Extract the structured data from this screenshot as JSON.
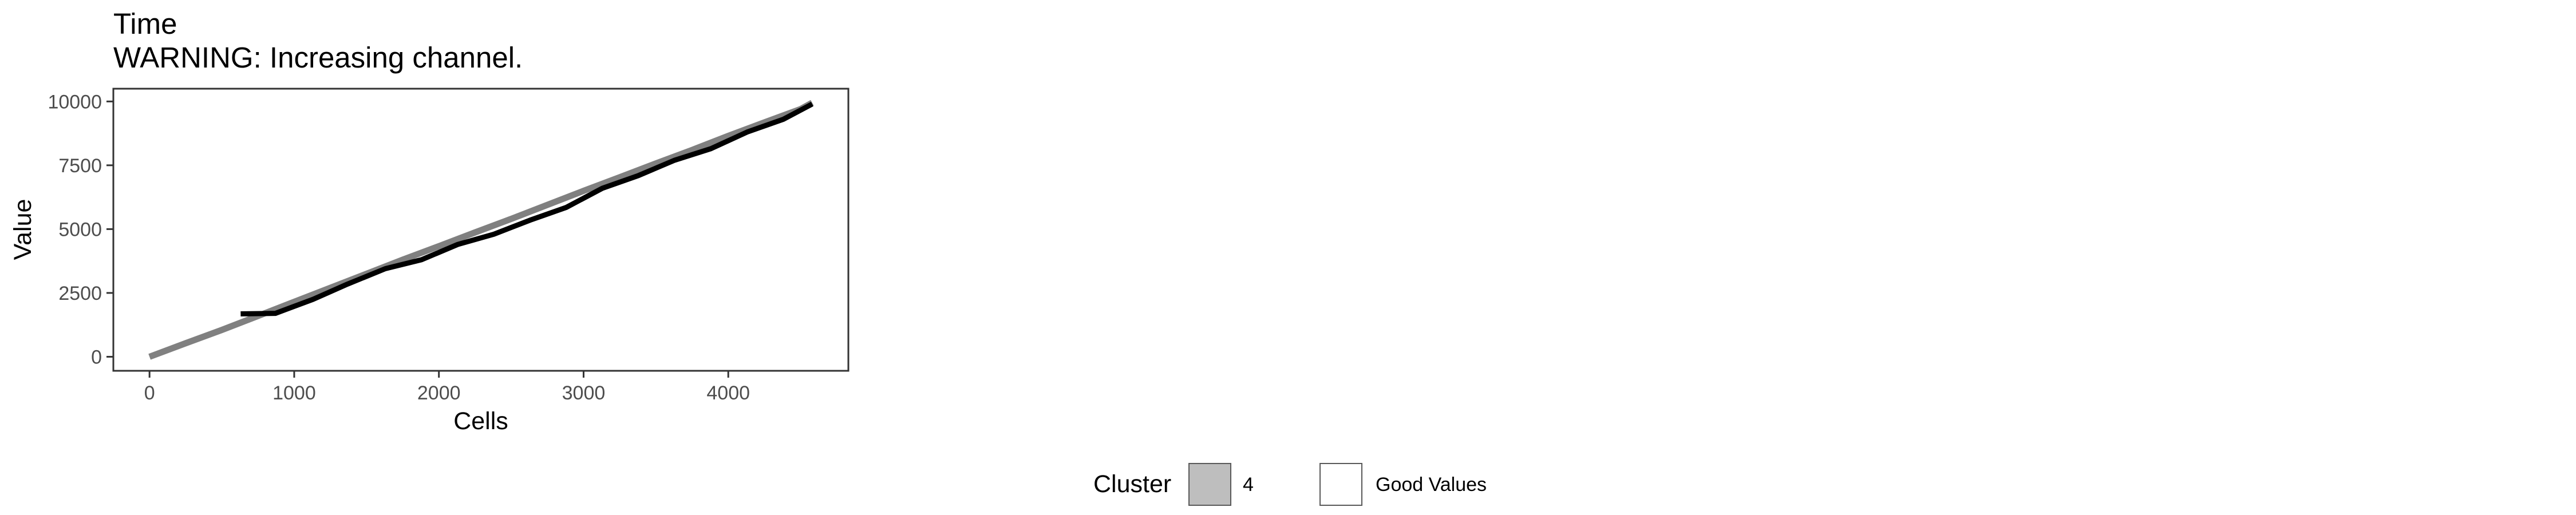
{
  "chart_data": {
    "type": "line",
    "title": "Time",
    "subtitle": "WARNING: Increasing channel.",
    "xlabel": "Cells",
    "ylabel": "Value",
    "xlim": [
      -250,
      4830
    ],
    "ylim": [
      -550,
      10500
    ],
    "x_ticks": [
      0,
      1000,
      2000,
      3000,
      4000
    ],
    "x_tick_labels": [
      "0",
      "1000",
      "2000",
      "3000",
      "4000"
    ],
    "y_ticks": [
      0,
      2500,
      5000,
      7500,
      10000
    ],
    "y_tick_labels": [
      "0",
      "2500",
      "5000",
      "7500",
      "10000"
    ],
    "grid": false,
    "legend_position": "bottom",
    "series": [
      {
        "color": "#808080",
        "role": "cluster",
        "x": [
          0,
          250,
          500,
          750,
          1000,
          1250,
          1500,
          1750,
          2000,
          2250,
          2500,
          2750,
          3000,
          3250,
          3500,
          3750,
          4000,
          4250,
          4500,
          4580
        ],
        "y": [
          0,
          530,
          1050,
          1600,
          2150,
          2700,
          3250,
          3800,
          4330,
          4870,
          5400,
          5950,
          6500,
          7030,
          7570,
          8100,
          8650,
          9180,
          9700,
          9950
        ]
      },
      {
        "color": "#000000",
        "role": "good-values",
        "x": [
          630,
          870,
          1130,
          1370,
          1630,
          1880,
          2130,
          2380,
          2630,
          2880,
          3130,
          3380,
          3630,
          3880,
          4130,
          4380,
          4580
        ],
        "y": [
          1680,
          1700,
          2250,
          2850,
          3450,
          3800,
          4400,
          4800,
          5350,
          5850,
          6600,
          7100,
          7700,
          8150,
          8800,
          9300,
          9900
        ]
      }
    ]
  },
  "legend": {
    "title": "Cluster",
    "items": [
      {
        "label": "4",
        "fill": "#bebebe",
        "stroke": "#595959"
      },
      {
        "label": "Good Values",
        "fill": "#ffffff",
        "stroke": "#595959"
      }
    ]
  },
  "colors": {
    "cluster_line": "#808080",
    "good_values_line": "#000000",
    "panel_border": "#333333",
    "tick_label": "#4d4d4d",
    "background": "#ffffff"
  }
}
